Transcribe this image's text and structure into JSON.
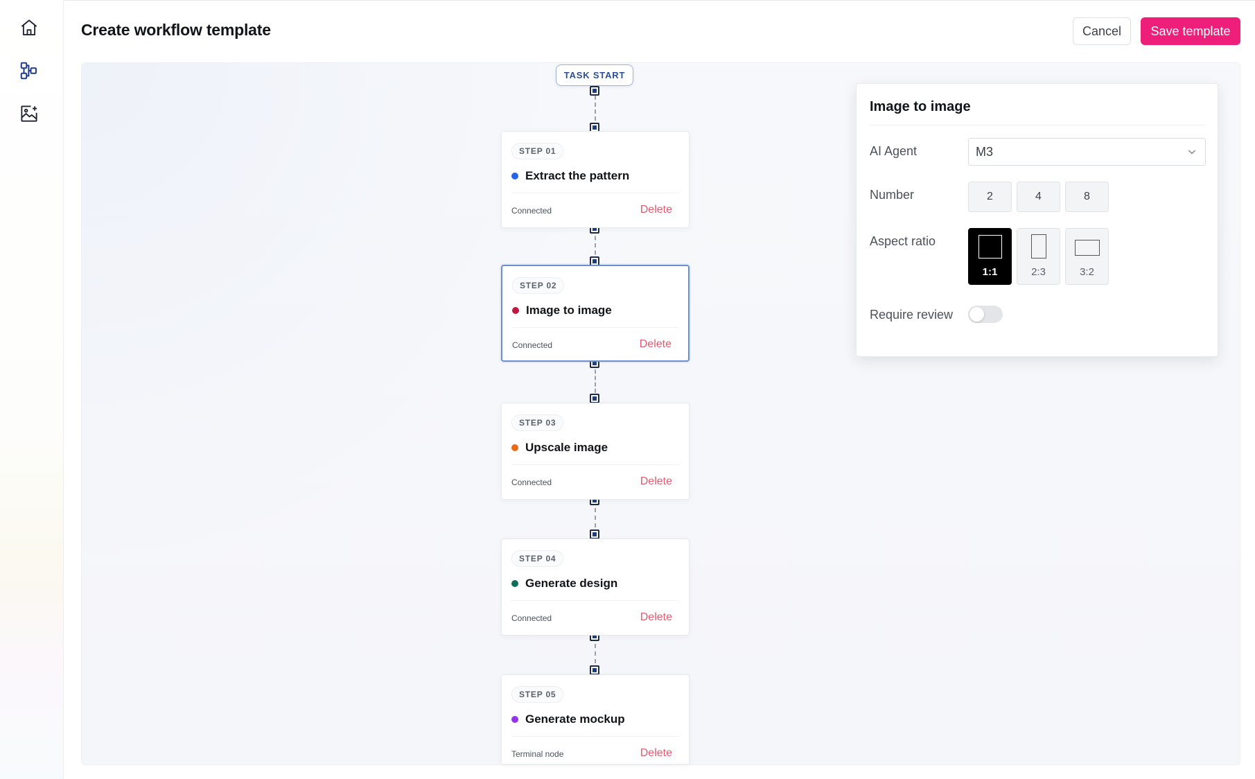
{
  "header": {
    "title": "Create workflow template",
    "cancel_label": "Cancel",
    "save_label": "Save template"
  },
  "rail": {
    "items": [
      {
        "icon": "home-icon"
      },
      {
        "icon": "workflow-icon"
      },
      {
        "icon": "gallery-icon"
      }
    ]
  },
  "canvas": {
    "task_start_label": "TASK START",
    "steps": [
      {
        "chip": "STEP 01",
        "title": "Extract the pattern",
        "status": "Connected",
        "delete_label": "Delete",
        "dot_color": "#2563eb"
      },
      {
        "chip": "STEP 02",
        "title": "Image to image",
        "status": "Connected",
        "delete_label": "Delete",
        "dot_color": "#c0183f",
        "selected": true
      },
      {
        "chip": "STEP 03",
        "title": "Upscale image",
        "status": "Connected",
        "delete_label": "Delete",
        "dot_color": "#ea6a17"
      },
      {
        "chip": "STEP 04",
        "title": "Generate design",
        "status": "Connected",
        "delete_label": "Delete",
        "dot_color": "#0f6e5a"
      },
      {
        "chip": "STEP 05",
        "title": "Generate mockup",
        "status": "Terminal node",
        "delete_label": "Delete",
        "dot_color": "#9333ea"
      }
    ]
  },
  "panel": {
    "title": "Image to image",
    "ai_agent_label": "AI Agent",
    "ai_agent_value": "M3",
    "number_label": "Number",
    "number_options": [
      "2",
      "4",
      "8"
    ],
    "aspect_label": "Aspect ratio",
    "aspect_options": [
      "1:1",
      "2:3",
      "3:2"
    ],
    "aspect_selected": "1:1",
    "require_review_label": "Require review",
    "require_review_on": false
  },
  "colors": {
    "accent": "#ee1f7a",
    "selected_border": "#6a8fca",
    "delete": "#e25a6f"
  }
}
